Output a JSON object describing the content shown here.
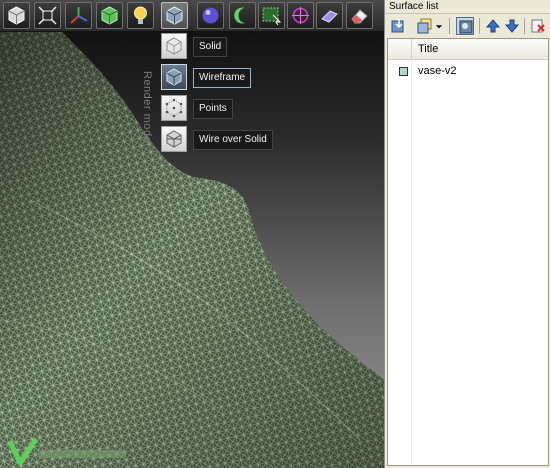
{
  "toolbar": {
    "buttons": [
      {
        "icon": "box-select-icon"
      },
      {
        "icon": "fit-view-icon"
      },
      {
        "icon": "axes-icon"
      },
      {
        "icon": "wire-cube-icon"
      },
      {
        "icon": "light-bulb-icon"
      },
      {
        "icon": "render-mode-icon"
      },
      {
        "icon": "material-sphere-icon"
      },
      {
        "icon": "lasso-select-icon"
      },
      {
        "icon": "rect-select-icon"
      },
      {
        "icon": "transform-gizmo-icon"
      },
      {
        "icon": "eraser-tool-icon"
      },
      {
        "icon": "eraser-icon"
      }
    ]
  },
  "render_mode": {
    "side_label": "Render mode",
    "options": [
      {
        "label": "Solid",
        "icon": "solid-cube-icon",
        "active": false
      },
      {
        "label": "Wireframe",
        "icon": "wireframe-cube-icon",
        "active": true
      },
      {
        "label": "Points",
        "icon": "points-cube-icon",
        "active": false
      },
      {
        "label": "Wire over Solid",
        "icon": "wire-over-solid-cube-icon",
        "active": false
      }
    ]
  },
  "surface_panel": {
    "title": "Surface list",
    "toolbar_icons": [
      "import-icon",
      "duplicate-icon",
      "dropdown-arrow-icon",
      "show-all-icon",
      "move-up-icon",
      "move-down-icon",
      "delete-icon"
    ],
    "columns": [
      "Title"
    ],
    "rows": [
      {
        "title": "vase-v2",
        "color": "#a9d9cf"
      }
    ]
  },
  "colors": {
    "mesh_fill": "#5d6e54",
    "mesh_wire": "#c9ecc2",
    "accent": "#6c7f90"
  }
}
